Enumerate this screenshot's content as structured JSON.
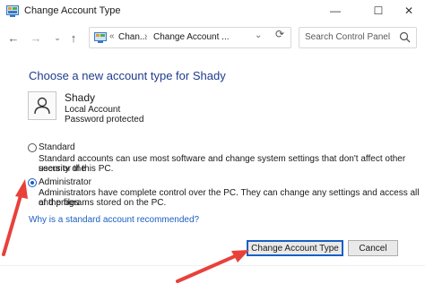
{
  "window": {
    "title": "Change Account Type",
    "minimize": "—",
    "maximize": "☐",
    "close": "✕"
  },
  "nav": {
    "back": "←",
    "forward": "→",
    "recent": "⌄",
    "up": "↑",
    "breadcrumb_overflow": "«",
    "breadcrumb_1": "Chan...",
    "breadcrumb_sep": "›",
    "breadcrumb_2": "Change Account ...",
    "breadcrumb_dropdown": "⌄",
    "refresh": "⟳",
    "search_placeholder": "Search Control Panel"
  },
  "main": {
    "heading": "Choose a new account type for Shady",
    "account": {
      "name": "Shady",
      "type": "Local Account",
      "password": "Password protected"
    },
    "options": [
      {
        "label": "Standard",
        "desc_line1": "Standard accounts can use most software and change system settings that don't affect other users or the",
        "desc_line2": "security of this PC.",
        "selected": false
      },
      {
        "label": "Administrator",
        "desc_line1": "Administrators have complete control over the PC. They can change any settings and access all of the files",
        "desc_line2": "and programs stored on the PC.",
        "selected": true
      }
    ],
    "why_link": "Why is a standard account recommended?"
  },
  "buttons": {
    "change": "Change Account Type",
    "cancel": "Cancel"
  },
  "colors": {
    "heading": "#1e3c8c",
    "link": "#1a5fc4",
    "annotation_arrow": "#e8413a"
  }
}
